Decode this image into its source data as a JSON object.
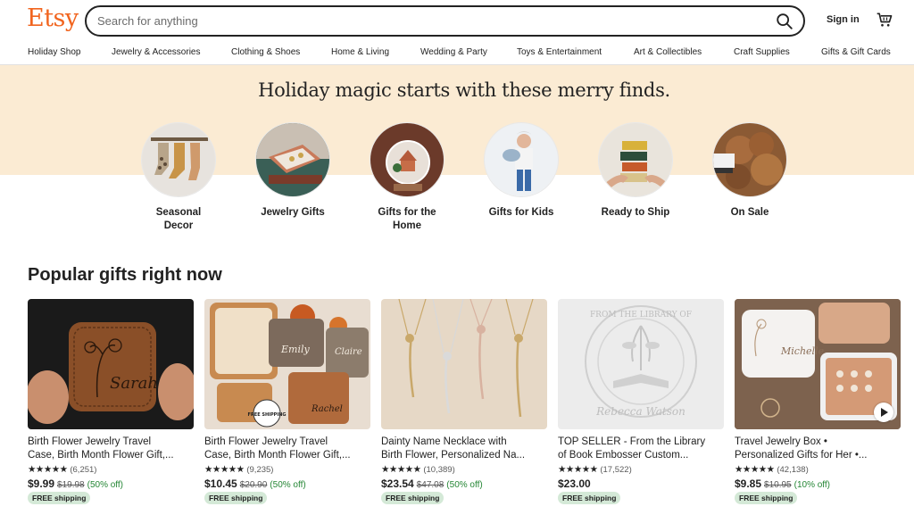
{
  "header": {
    "logo": "Etsy",
    "search_placeholder": "Search for anything",
    "signin": "Sign in"
  },
  "categories": [
    "Holiday Shop",
    "Jewelry & Accessories",
    "Clothing & Shoes",
    "Home & Living",
    "Wedding & Party",
    "Toys & Entertainment",
    "Art & Collectibles",
    "Craft Supplies",
    "Gifts & Gift Cards"
  ],
  "hero": {
    "title": "Holiday magic starts with these merry finds.",
    "circles": [
      {
        "label": "Seasonal Decor"
      },
      {
        "label": "Jewelry Gifts"
      },
      {
        "label": "Gifts for the Home"
      },
      {
        "label": "Gifts for Kids"
      },
      {
        "label": "Ready to Ship"
      },
      {
        "label": "On Sale"
      }
    ]
  },
  "popular": {
    "title": "Popular gifts right now",
    "items": [
      {
        "title1": "Birth Flower Jewelry Travel",
        "title2": "Case, Birth Month Flower Gift,...",
        "stars": "★★★★★",
        "count": "(6,251)",
        "price": "$9.99",
        "was": "$19.98",
        "off": "(50% off)",
        "ship": "FREE shipping"
      },
      {
        "title1": "Birth Flower Jewelry Travel",
        "title2": "Case, Birth Month Flower Gift,...",
        "stars": "★★★★★",
        "count": "(9,235)",
        "price": "$10.45",
        "was": "$20.90",
        "off": "(50% off)",
        "ship": "FREE shipping"
      },
      {
        "title1": "Dainty Name Necklace with",
        "title2": "Birth Flower, Personalized Na...",
        "stars": "★★★★★",
        "count": "(10,389)",
        "price": "$23.54",
        "was": "$47.08",
        "off": "(50% off)",
        "ship": "FREE shipping"
      },
      {
        "title1": "TOP SELLER - From the Library",
        "title2": "of Book Embosser Custom...",
        "stars": "★★★★★",
        "count": "(17,522)",
        "price": "$23.00",
        "was": "",
        "off": "",
        "ship": "FREE shipping"
      },
      {
        "title1": "Travel Jewelry Box •",
        "title2": "Personalized Gifts for Her •...",
        "stars": "★★★★★",
        "count": "(42,138)",
        "price": "$9.85",
        "was": "$10.95",
        "off": "(10% off)",
        "ship": "FREE shipping"
      }
    ],
    "image_text": {
      "sarah": "Sarah",
      "emily": "Emily",
      "claire": "Claire",
      "rachel": "Rachel",
      "free_shipping_badge": "FREE SHIPPING",
      "embosser_top": "FROM THE LIBRARY OF",
      "embosser_name": "Rebecca Watson",
      "michelle": "Michelle"
    }
  },
  "colors": {
    "brand": "#f1641e",
    "hero_bg": "#fbebd3",
    "sale_green": "#258635",
    "ship_badge": "#d4e9d7"
  },
  "icons": [
    "search-icon",
    "cart-icon",
    "play-icon",
    "star-icon"
  ]
}
